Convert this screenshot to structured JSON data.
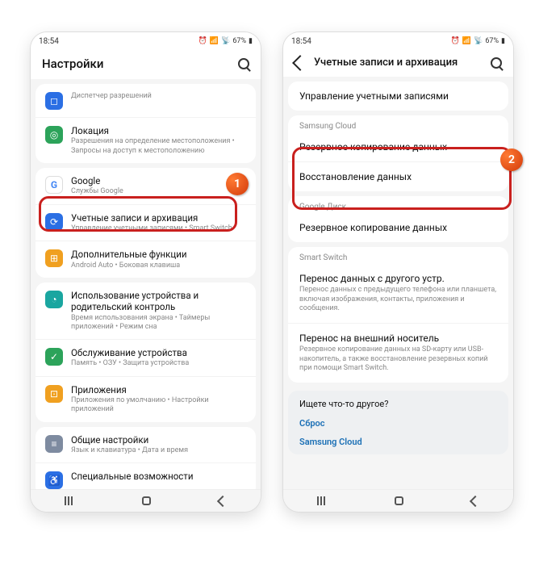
{
  "status": {
    "time": "18:54",
    "battery": "67%"
  },
  "left": {
    "title": "Настройки",
    "items": [
      {
        "icon": "permissions-icon",
        "color": "ic-blue",
        "title": "",
        "sub": "Диспетчер разрешений",
        "partial": true
      },
      {
        "icon": "location-icon",
        "color": "ic-green",
        "title": "Локация",
        "sub": "Разрешения на определение местоположения • Запросы на доступ к местоположению"
      },
      {
        "icon": "google-icon",
        "color": "ic-white",
        "title": "Google",
        "sub": "Службы Google"
      },
      {
        "icon": "accounts-icon",
        "color": "ic-blue",
        "title": "Учетные записи и архивация",
        "sub": "Управление учетными записями • Smart Switch",
        "hl": true
      },
      {
        "icon": "advanced-icon",
        "color": "ic-orange",
        "title": "Дополнительные функции",
        "sub": "Android Auto • Боковая клавиша"
      },
      {
        "icon": "wellbeing-icon",
        "color": "ic-teal",
        "title": "Использование устройства и родительский контроль",
        "sub": "Время использования экрана • Таймеры приложений • Режим сна"
      },
      {
        "icon": "care-icon",
        "color": "ic-green",
        "title": "Обслуживание устройства",
        "sub": "Память • ОЗУ • Защита устройства"
      },
      {
        "icon": "apps-icon",
        "color": "ic-orange",
        "title": "Приложения",
        "sub": "Приложения по умолчанию • Настройки приложений"
      },
      {
        "icon": "general-icon",
        "color": "ic-grey",
        "title": "Общие настройки",
        "sub": "Язык и клавиатура • Дата и время"
      },
      {
        "icon": "a11y-icon",
        "color": "ic-blue",
        "title": "Специальные возможности",
        "sub": ""
      }
    ]
  },
  "right": {
    "title": "Учетные записи и архивация",
    "manage": "Управление учетными записями",
    "sections": [
      {
        "label": "Samsung Cloud",
        "rows": [
          {
            "title": "Резервное копирование данных",
            "sub": ""
          },
          {
            "title": "Восстановление данных",
            "sub": "",
            "hl": true
          }
        ]
      },
      {
        "label": "Google Диск",
        "rows": [
          {
            "title": "Резервное копирование данных",
            "sub": ""
          }
        ]
      },
      {
        "label": "Smart Switch",
        "rows": [
          {
            "title": "Перенос данных с другого устр.",
            "sub": "Перенос данных с предыдущего телефона или планшета, включая изображения, контакты, приложения и сообщения."
          },
          {
            "title": "Перенос на внешний носитель",
            "sub": "Резервное копирование данных на SD-карту или USB-накопитель, а также восстановление резервных копий при помощи Smart Switch."
          }
        ]
      }
    ],
    "howto": {
      "title": "Ищете что-то другое?",
      "links": [
        "Сброс",
        "Samsung Cloud"
      ]
    }
  },
  "badges": {
    "one": "1",
    "two": "2"
  }
}
